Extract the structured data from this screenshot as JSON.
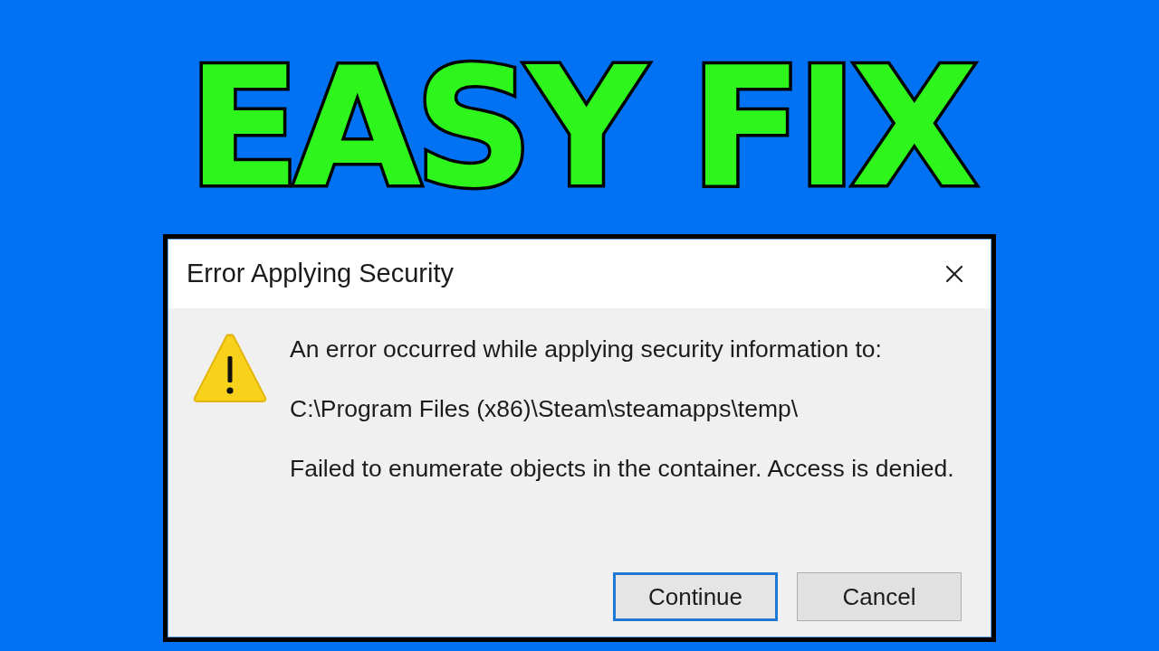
{
  "headline": "EASY FIX",
  "dialog": {
    "title": "Error Applying Security",
    "messages": [
      "An error occurred while applying security information to:",
      "C:\\Program Files (x86)\\Steam\\steamapps\\temp\\",
      "Failed to enumerate objects in the container. Access is denied."
    ],
    "buttons": [
      {
        "label": "Continue",
        "default": true
      },
      {
        "label": "Cancel",
        "default": false
      }
    ]
  }
}
